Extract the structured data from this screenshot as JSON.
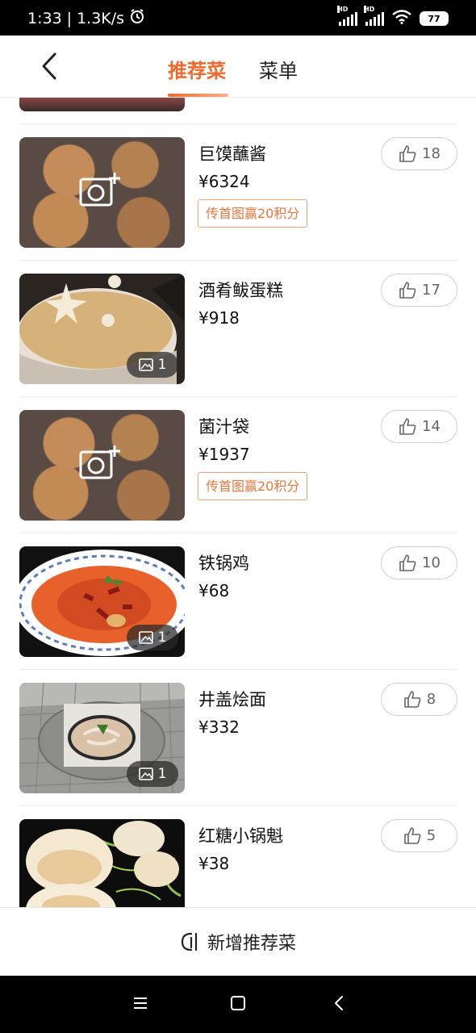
{
  "status_bar": {
    "time": "1:33",
    "network_speed": "1.3K/s",
    "battery": "77",
    "signal_label": "HD"
  },
  "header": {
    "tabs": [
      {
        "label": "推荐菜",
        "active": true
      },
      {
        "label": "菜单",
        "active": false
      }
    ],
    "accent_color": "#ee6a2c"
  },
  "dishes": [
    {
      "name": "巨馍蘸酱",
      "price": "¥6324",
      "likes": "18",
      "promo": "传首图赢20积分",
      "photo_count": null,
      "image": "placeholder"
    },
    {
      "name": "酒肴鲅蛋糕",
      "price": "¥918",
      "likes": "17",
      "promo": null,
      "photo_count": "1",
      "image": "sand-cake"
    },
    {
      "name": "菌汁袋",
      "price": "¥1937",
      "likes": "14",
      "promo": "传首图赢20积分",
      "photo_count": null,
      "image": "placeholder"
    },
    {
      "name": "铁锅鸡",
      "price": "¥68",
      "likes": "10",
      "promo": null,
      "photo_count": "1",
      "image": "chicken-stew"
    },
    {
      "name": "井盖烩面",
      "price": "¥332",
      "likes": "8",
      "promo": null,
      "photo_count": "1",
      "image": "noodle-manhole"
    },
    {
      "name": "红糖小锅魁",
      "price": "¥38",
      "likes": "5",
      "promo": null,
      "photo_count": null,
      "image": "buns"
    }
  ],
  "add_button": {
    "label": "新增推荐菜",
    "icon": "add-dish-icon"
  },
  "nav_bar": {
    "icons": [
      "menu-icon",
      "home-icon",
      "back-icon"
    ]
  }
}
